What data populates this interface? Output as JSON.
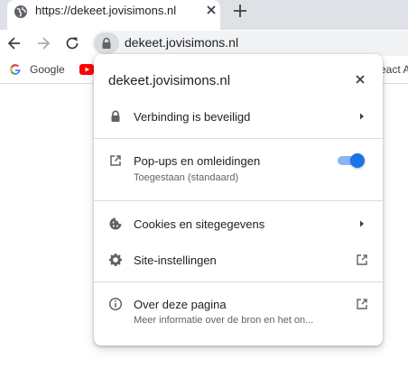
{
  "tab": {
    "title": "https://dekeet.jovisimons.nl"
  },
  "address_bar": {
    "url": "dekeet.jovisimons.nl"
  },
  "bookmarks": {
    "google_label": "Google",
    "react_label": "eact A"
  },
  "site_info_popup": {
    "title": "dekeet.jovisimons.nl",
    "connection_label": "Verbinding is beveiligd",
    "popups": {
      "label": "Pop-ups en omleidingen",
      "status": "Toegestaan (standaard)",
      "enabled": true
    },
    "cookies_label": "Cookies en sitegegevens",
    "site_settings_label": "Site-instellingen",
    "about": {
      "label": "Over deze pagina",
      "description": "Meer informatie over de bron en het on..."
    }
  },
  "colors": {
    "accent": "#1a73e8",
    "toggle_track": "#8ab4f8",
    "youtube_red": "#ff0000"
  }
}
